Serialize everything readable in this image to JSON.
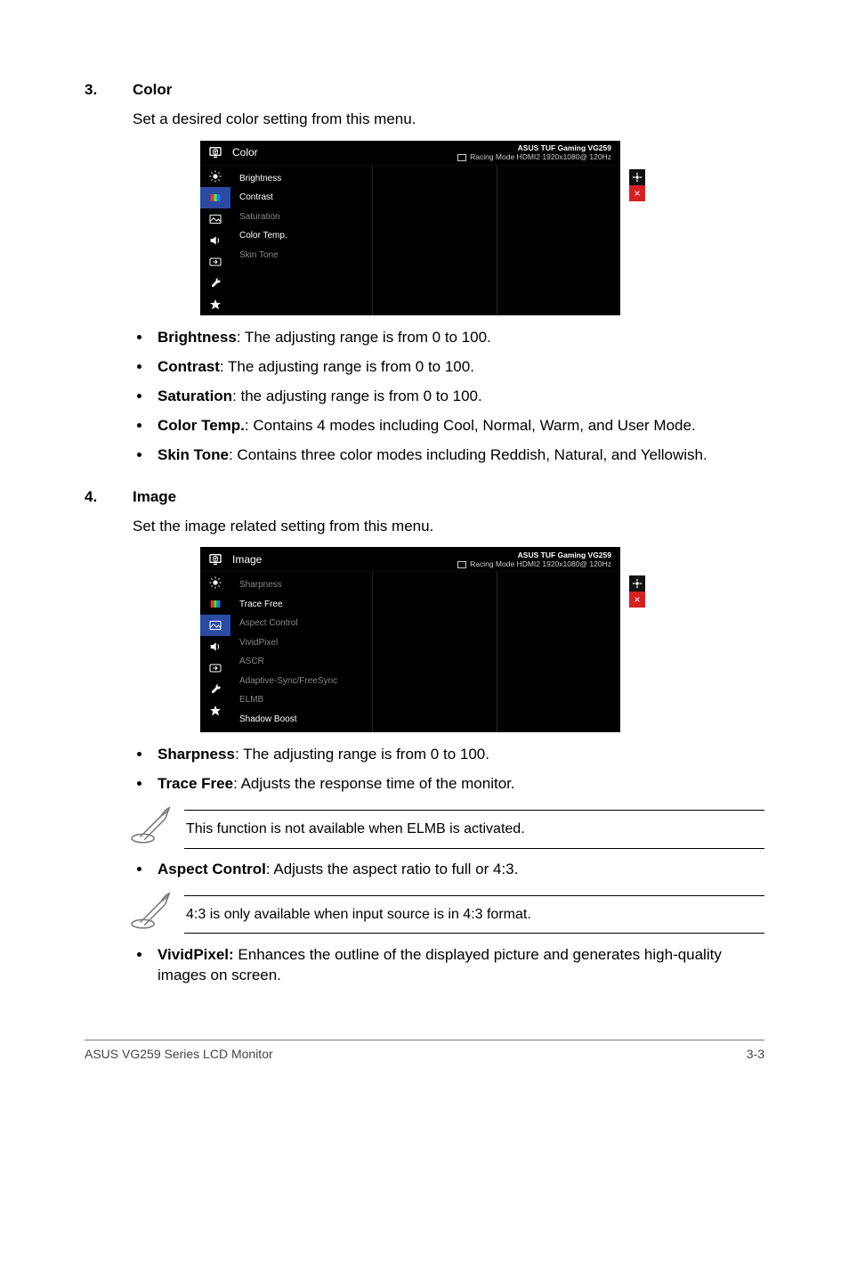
{
  "sections": {
    "color": {
      "num": "3.",
      "title": "Color",
      "desc": "Set a desired color setting from this menu.",
      "bullets": [
        {
          "term": "Brightness",
          "rest": ": The adjusting range is from 0 to 100."
        },
        {
          "term": "Contrast",
          "rest": ": The adjusting range is from 0 to 100."
        },
        {
          "term": "Saturation",
          "rest": ": the adjusting range is from 0 to 100."
        },
        {
          "term": "Color Temp.",
          "rest": ": Contains 4 modes including Cool, Normal, Warm, and User Mode."
        },
        {
          "term": "Skin Tone",
          "rest": ": Contains three color modes including Reddish, Natural, and Yellowish."
        }
      ]
    },
    "image": {
      "num": "4.",
      "title": "Image",
      "desc": "Set the image related setting from this menu.",
      "bullets_before_notes": [
        {
          "term": "Sharpness",
          "rest": ": The adjusting range is from 0 to 100."
        },
        {
          "term": "Trace Free",
          "rest": ": Adjusts the response time of the monitor."
        }
      ],
      "note1": "This function is not available when ELMB is activated.",
      "bullet_mid": {
        "term": "Aspect Control",
        "rest": ": Adjusts the aspect ratio to full or 4:3."
      },
      "note2": "4:3 is only available when input source is in 4:3 format.",
      "bullet_after": {
        "term": "VividPixel:",
        "rest": " Enhances the outline of the displayed picture and generates high-quality images on screen."
      }
    }
  },
  "osd": {
    "status_line1": "ASUS TUF Gaming  VG259",
    "status_line2": "Racing Mode HDMI2 1920x1080@ 120Hz",
    "color": {
      "title": "Color",
      "items": [
        {
          "label": "Brightness",
          "avail": true
        },
        {
          "label": "Contrast",
          "avail": true
        },
        {
          "label": "Saturation",
          "avail": false
        },
        {
          "label": "Color Temp.",
          "avail": true
        },
        {
          "label": "Skin Tone",
          "avail": false
        }
      ]
    },
    "image": {
      "title": "Image",
      "items": [
        {
          "label": "Sharpness",
          "avail": false
        },
        {
          "label": "Trace Free",
          "avail": true
        },
        {
          "label": "Aspect Control",
          "avail": false
        },
        {
          "label": "VividPixel",
          "avail": false
        },
        {
          "label": "ASCR",
          "avail": false
        },
        {
          "label": "Adaptive-Sync/FreeSync",
          "avail": false
        },
        {
          "label": "ELMB",
          "avail": false
        },
        {
          "label": "Shadow Boost",
          "avail": true
        }
      ]
    }
  },
  "footer": {
    "left": "ASUS VG259 Series LCD Monitor",
    "right": "3-3"
  },
  "icons": {
    "gamevisual": "G",
    "move": "✥",
    "close": "×"
  }
}
